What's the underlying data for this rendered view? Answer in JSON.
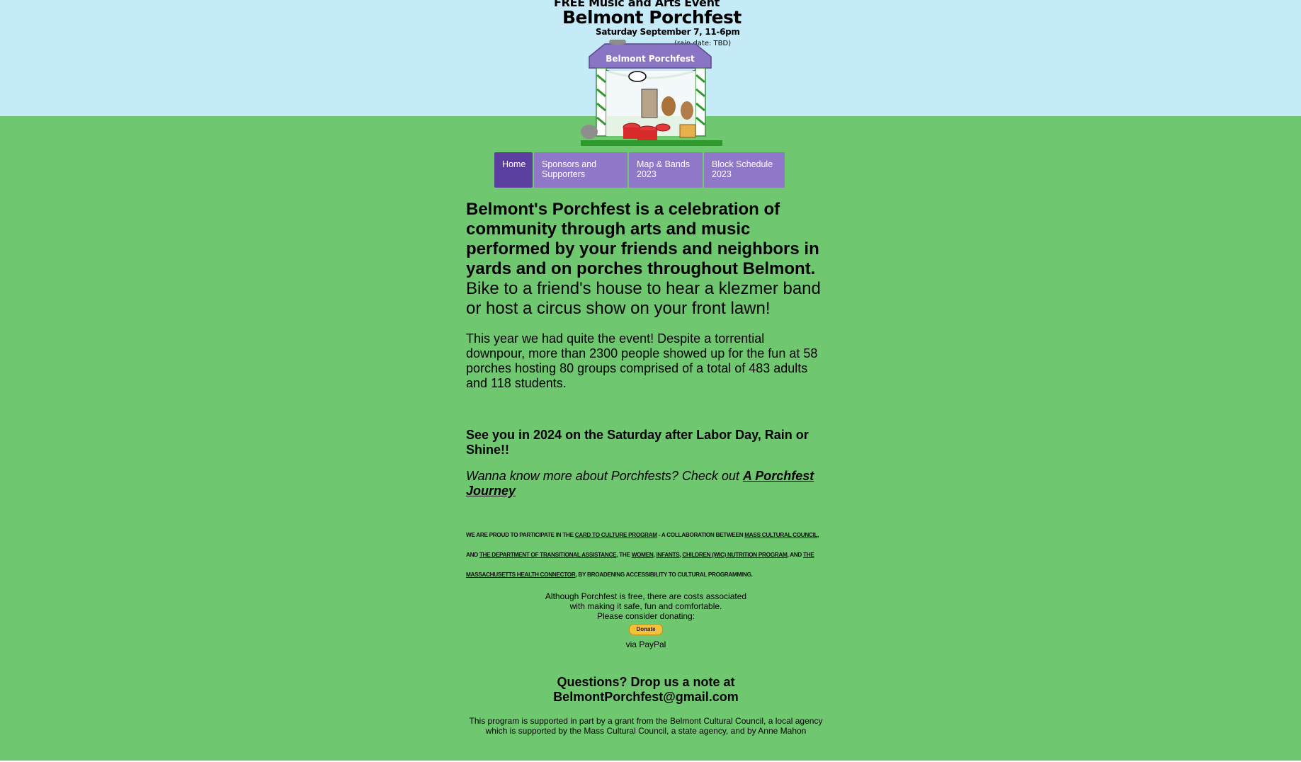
{
  "header": {
    "line1": "FREE Music and Arts Event",
    "title": "Belmont Porchfest",
    "date": "Saturday September 7, 11-6pm",
    "rain": "(rain date: TBD)",
    "roof_sign": "Belmont Porchfest"
  },
  "nav": {
    "items": [
      {
        "label": "Home",
        "active": true
      },
      {
        "label": "Sponsors and Supporters",
        "active": false
      },
      {
        "label": "Map & Bands 2023",
        "active": false
      },
      {
        "label": "Block Schedule 2023",
        "active": false
      }
    ]
  },
  "main": {
    "intro_bold": "Belmont's Porchfest is a celebration of community through arts and music performed by your friends and neighbors in yards and on porches throughout Belmont.",
    "intro_rest": " Bike to a friend's house to hear a klezmer band or host a circus show on your front lawn!",
    "recap": "This year we had quite the event! Despite a torrential downpour, more than 2300 people showed up for the fun at 58 porches hosting 80 groups comprised of a total of 483 adults and 118 students.",
    "see_you": "See you in 2024 on the Saturday after Labor Day, Rain or Shine!!",
    "wanna_text": "Wanna know more about Porchfests?  Check out ",
    "wanna_link": "A Porchfest Journey",
    "proud": {
      "t1": "We are proud to participate in the ",
      "l1": "Card to Culture program",
      "t2": " - a collaboration between ",
      "l2": "Mass Cultural Council",
      "t3": ", and ",
      "l3": "the Department of Transitional Assistance",
      "t4": ", the ",
      "l4": "Women",
      "t5": ", ",
      "l5": "Infants",
      "t6": ", ",
      "l6": "Children (WIC) Nutrition Program",
      "t7": ", and ",
      "l7": "the Massachusetts Health Connector",
      "t8": ", by broadening accessibility to cultural programming."
    },
    "donate_line1": "Although Porchfest is free, there are costs associated",
    "donate_line2": "with making it safe, fun and comfortable.",
    "donate_line3": "Please consider donating:",
    "donate_button": "Donate",
    "via_paypal": "via PayPal",
    "questions_line1": "Questions? Drop us a note at",
    "questions_email": "BelmontPorchfest@gmail.com",
    "support_line1": "This program is supported in part by a grant from the Belmont Cultural Council, a local agency",
    "support_line2": "which is supported by the Mass Cultural Council, a state agency, and by Anne Mahon"
  },
  "colors": {
    "sky": "#c6ebf8",
    "grass": "#6fc86f",
    "nav": "#8f78c8",
    "nav_active": "#5a3f9e"
  }
}
